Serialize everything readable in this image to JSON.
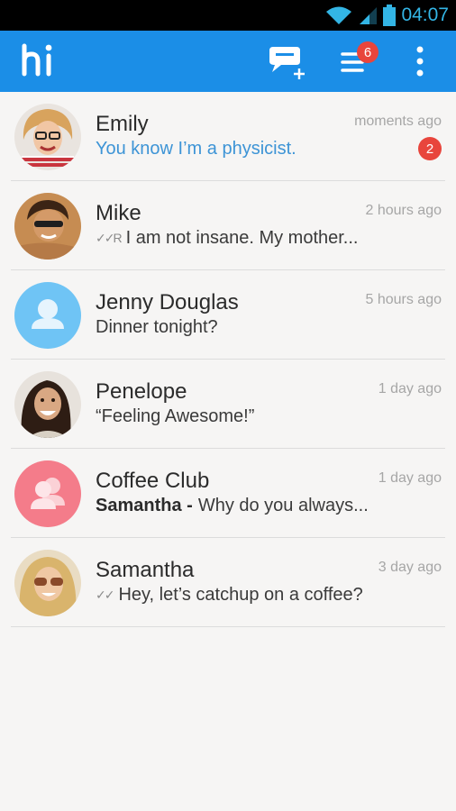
{
  "status_bar": {
    "time": "04:07"
  },
  "app_bar": {
    "logo_text": "hi",
    "menu_badge": "6"
  },
  "chats": [
    {
      "name": "Emily",
      "time": "moments ago",
      "preview": "You know I’m a physicist.",
      "unread": "2"
    },
    {
      "name": "Mike",
      "time": "2 hours ago",
      "tick": "✓✓R",
      "preview": "I am not insane. My mother..."
    },
    {
      "name": "Jenny Douglas",
      "time": "5 hours ago",
      "preview": "Dinner tonight?"
    },
    {
      "name": "Penelope",
      "time": "1 day ago",
      "preview": "“Feeling Awesome!”"
    },
    {
      "name": "Coffee Club",
      "time": "1 day ago",
      "sender": "Samantha -",
      "preview": "Why do you always..."
    },
    {
      "name": "Samantha",
      "time": "3 day ago",
      "tick": "✓✓",
      "preview": "Hey, let’s catchup on a coffee?"
    }
  ],
  "colors": {
    "app_bar": "#1b8ee7",
    "badge": "#e8453c",
    "highlight": "#3d94d6",
    "default_avatar": "#6fc4f5",
    "group_avatar": "#f47c8a"
  }
}
